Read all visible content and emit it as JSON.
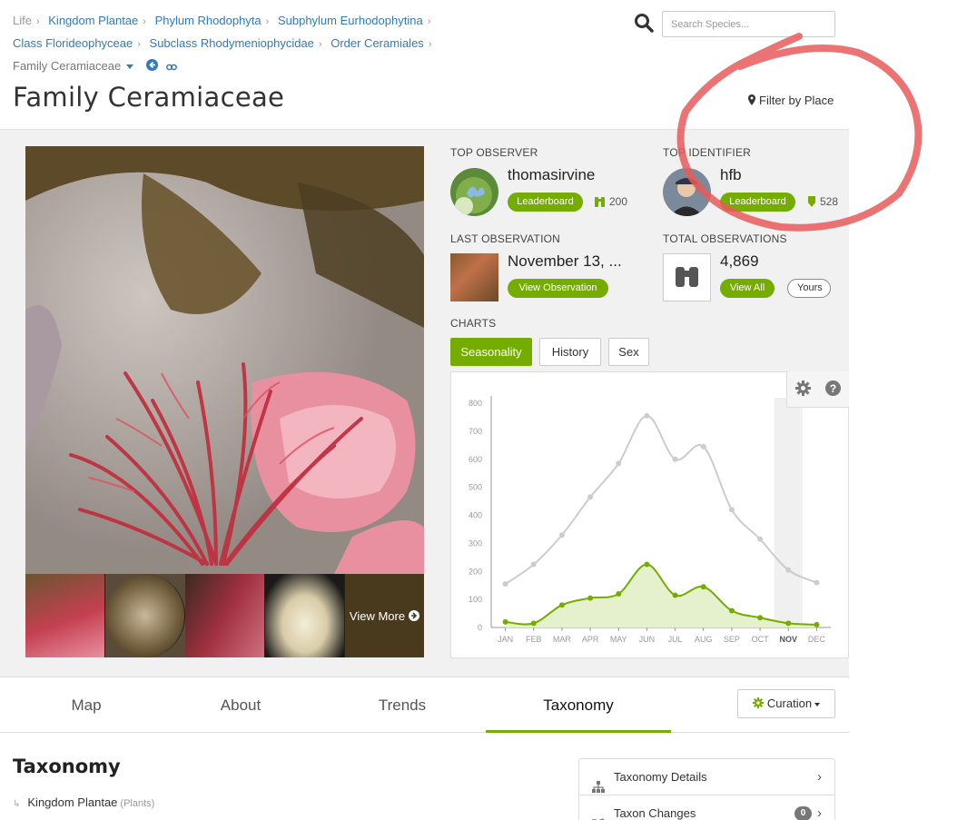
{
  "breadcrumb": {
    "items": [
      "Life",
      "Kingdom Plantae",
      "Phylum Rhodophyta",
      "Subphylum Eurhodophytina",
      "Class Florideophyceae",
      "Subclass Rhodymeniophycidae",
      "Order Ceramiales"
    ],
    "current": "Family Ceramiaceae"
  },
  "search": {
    "placeholder": "Search Species..."
  },
  "page_title": "Family Ceramiaceae",
  "filter_by_place": "Filter by Place",
  "photo": {
    "view_more": "View More"
  },
  "top_observer": {
    "label": "TOP OBSERVER",
    "name": "thomasirvine",
    "button": "Leaderboard",
    "count": "200"
  },
  "top_identifier": {
    "label": "TOP IDENTIFIER",
    "name": "hfb",
    "button": "Leaderboard",
    "count": "528"
  },
  "last_observation": {
    "label": "LAST OBSERVATION",
    "date": "November 13, ...",
    "button": "View Observation"
  },
  "total_observations": {
    "label": "TOTAL OBSERVATIONS",
    "value": "4,869",
    "view_all": "View All",
    "yours": "Yours"
  },
  "charts": {
    "label": "CHARTS",
    "tabs": [
      "Seasonality",
      "History",
      "Sex"
    ],
    "active_tab": "Seasonality"
  },
  "chart_data": {
    "type": "line",
    "categories": [
      "JAN",
      "FEB",
      "MAR",
      "APR",
      "MAY",
      "JUN",
      "JUL",
      "AUG",
      "SEP",
      "OCT",
      "NOV",
      "DEC"
    ],
    "highlight_category": "NOV",
    "ylim": [
      0,
      800
    ],
    "yticks": [
      0,
      100,
      200,
      300,
      400,
      500,
      600,
      700,
      800
    ],
    "series": [
      {
        "values": [
          155,
          225,
          330,
          465,
          585,
          755,
          600,
          645,
          420,
          315,
          205,
          160
        ],
        "color": "#cccccc"
      },
      {
        "values": [
          20,
          15,
          80,
          105,
          120,
          225,
          115,
          145,
          60,
          35,
          15,
          10
        ],
        "color": "#74ac00",
        "fill": "#e5f0cc"
      }
    ]
  },
  "nav_tabs": [
    "Map",
    "About",
    "Trends",
    "Taxonomy"
  ],
  "active_nav": "Taxonomy",
  "curation": "Curation",
  "taxonomy": {
    "title": "Taxonomy",
    "rows": [
      {
        "name": "Kingdom Plantae",
        "common": "(Plants)"
      }
    ]
  },
  "side_menu": [
    {
      "label": "Taxonomy Details"
    },
    {
      "label": "Taxon Changes",
      "badge": "0"
    }
  ],
  "colors": {
    "accent": "#74ac00",
    "link": "#337ab7",
    "annotation": "#e84b4b"
  }
}
